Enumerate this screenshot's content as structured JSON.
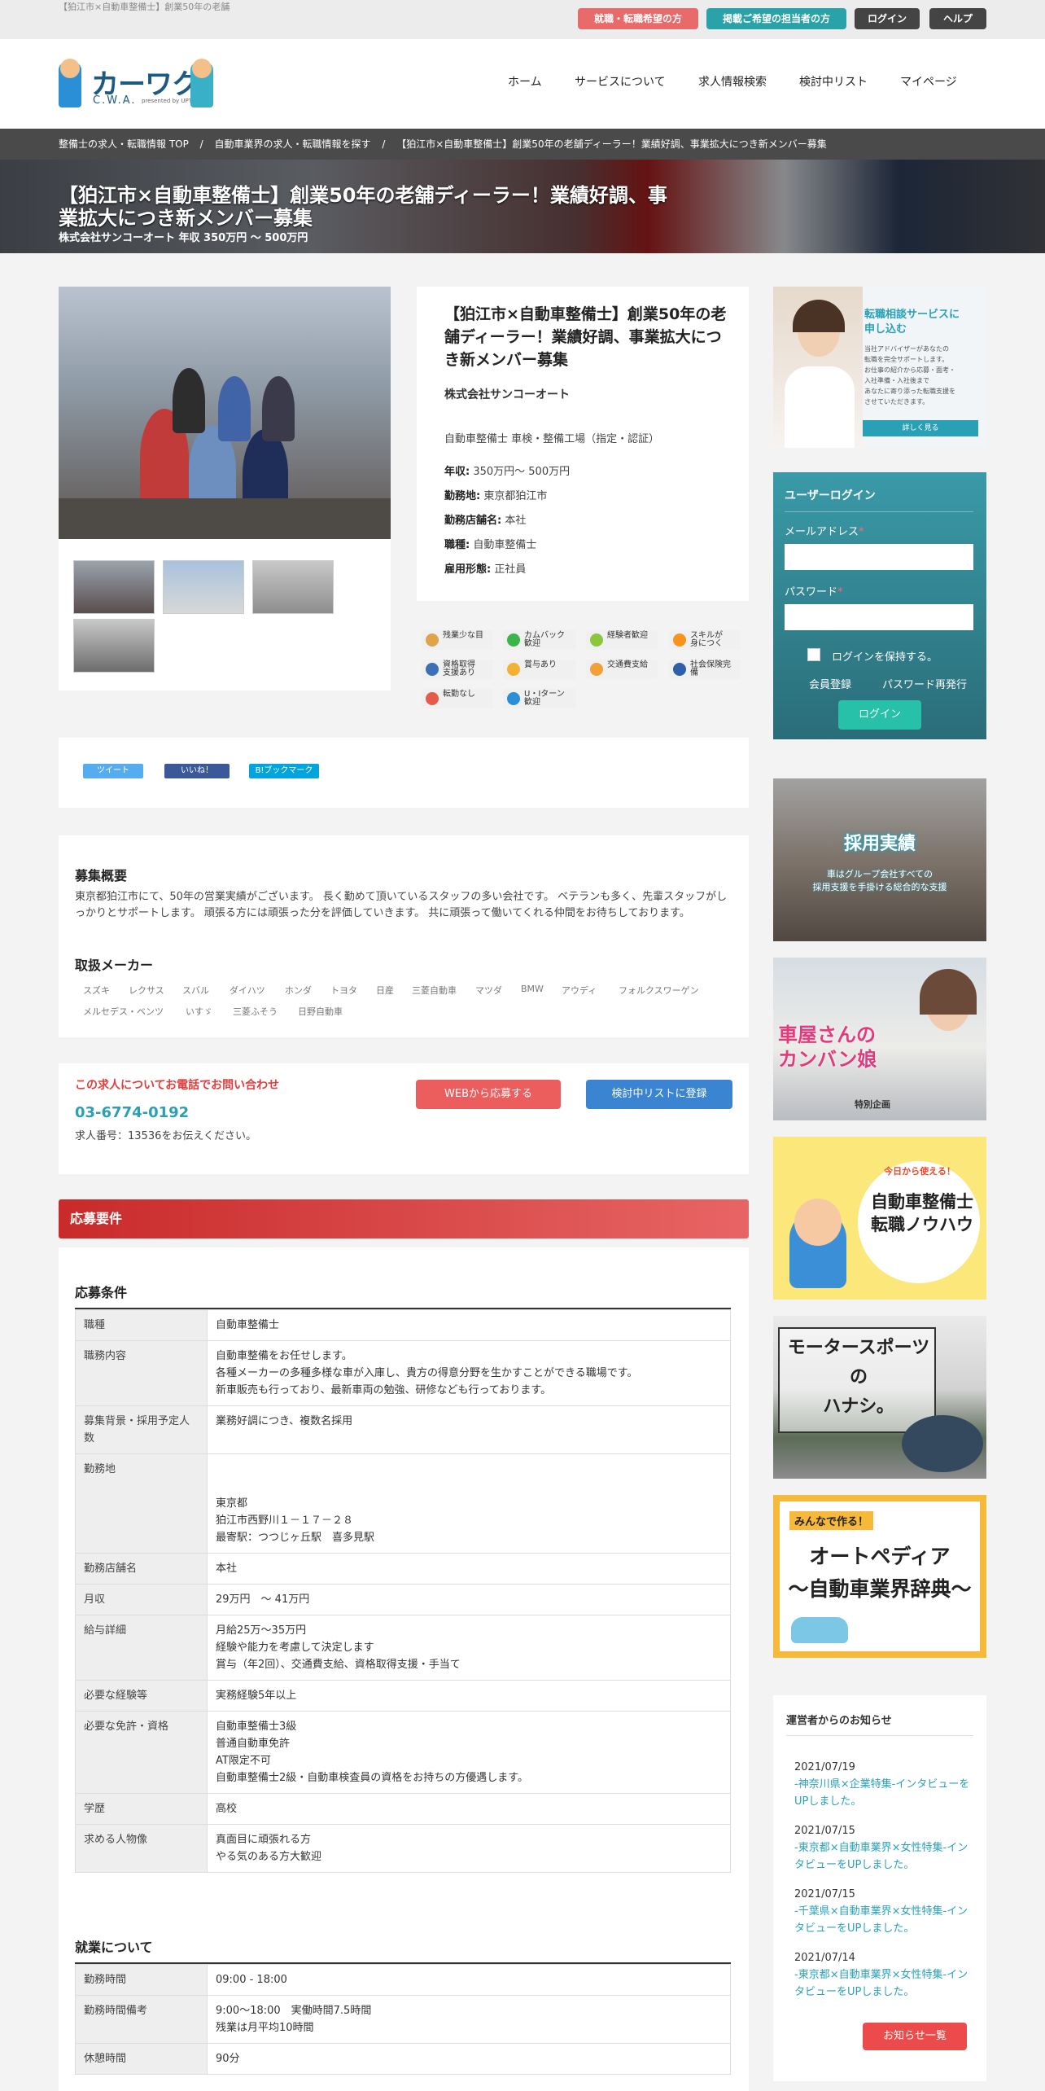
{
  "topbar": {
    "tagline": "【狛江市×自動車整備士】創業50年の老舗",
    "btn_jobseeker": "就職・転職希望の方",
    "btn_employer": "掲載ご希望の担当者の方",
    "btn_login": "ログイン",
    "btn_help": "ヘルプ"
  },
  "header": {
    "logo_text": "カーワク",
    "logo_sub": "C.W.A.",
    "logo_powered": "presented by UPTV",
    "nav": [
      "ホーム",
      "サービスについて",
      "求人情報検索",
      "検討中リスト",
      "マイページ"
    ]
  },
  "breadcrumb": {
    "items": [
      "整備士の求人・転職情報 TOP",
      "/",
      "自動車業界の求人・転職情報を探す",
      "/",
      "【狛江市×自動車整備士】創業50年の老舗ディーラー！業績好調、事業拡大につき新メンバー募集"
    ]
  },
  "hero": {
    "title": "【狛江市×自動車整備士】創業50年の老舗ディーラー！業績好調、事業拡大につき新メンバー募集",
    "subtitle": "株式会社サンコーオート 年収 350万円 〜 500万円"
  },
  "job": {
    "title": "【狛江市×自動車整備士】創業50年の老舗ディーラー！業績好調、事業拡大につき新メンバー募集",
    "company": "株式会社サンコーオート",
    "description": "自動車整備士 車検・整備工場（指定・認証）",
    "fields": [
      {
        "label": "年収:",
        "value": " 350万円〜 500万円"
      },
      {
        "label": "勤務地:",
        "value": " 東京都狛江市"
      },
      {
        "label": "勤務店舗名:",
        "value": " 本社"
      },
      {
        "label": "職種:",
        "value": " 自動車整備士"
      },
      {
        "label": "雇用形態:",
        "value": " 正社員"
      }
    ]
  },
  "badges": [
    {
      "label": "残業少な目",
      "color": "#e0a24a"
    },
    {
      "label": "カムバック\n歓迎",
      "color": "#39b54a"
    },
    {
      "label": "経験者歓迎",
      "color": "#8cc63f"
    },
    {
      "label": "スキルが\n身につく",
      "color": "#f7931e"
    },
    {
      "label": "資格取得\n支援あり",
      "color": "#3b6fb6"
    },
    {
      "label": "賞与あり",
      "color": "#f2b134"
    },
    {
      "label": "交通費支給",
      "color": "#f2a03a"
    },
    {
      "label": "社会保険完備",
      "color": "#2e5fa8"
    },
    {
      "label": "転勤なし",
      "color": "#e55a4a"
    },
    {
      "label": "U・Iターン\n歓迎",
      "color": "#2a8fd6"
    }
  ],
  "share": {
    "tweet": "ツイート",
    "like": "いいね！",
    "bookmark": "B!ブックマーク"
  },
  "overview": {
    "heading": "募集概要",
    "text": "東京都狛江市にて、50年の営業実績がございます。 長く勤めて頂いているスタッフの多い会社です。 ベテランも多く、先輩スタッフがしっかりとサポートします。 頑張る方には頑張った分を評価していきます。 共に頑張って働いてくれる仲間をお待ちしております。",
    "makers_heading": "取扱メーカー",
    "makers": [
      "スズキ",
      "レクサス",
      "スバル",
      "ダイハツ",
      "ホンダ",
      "トヨタ",
      "日産",
      "三菱自動車",
      "マツダ",
      "BMW",
      "アウディ",
      "フォルクスワーゲン",
      "メルセデス・ベンツ",
      "いすゞ",
      "三菱ふそう",
      "日野自動車"
    ]
  },
  "contact": {
    "heading": "この求人についてお電話でお問い合わせ",
    "phone": "03-6774-0192",
    "job_no": "求人番号：13536をお伝えください。",
    "btn_apply": "WEBから応募する",
    "btn_list": "検討中リストに登録"
  },
  "requirements": {
    "bar": "応募要件",
    "conditions_heading": "応募条件",
    "conditions": [
      {
        "k": "職種",
        "v": "自動車整備士"
      },
      {
        "k": "職務内容",
        "v": "自動車整備をお任せします。\n各種メーカーの多種多様な車が入庫し、貴方の得意分野を生かすことができる職場です。\n新車販売も行っており、最新車両の勉強、研修なども行っております。"
      },
      {
        "k": "募集背景・採用予定人数",
        "v": "業務好調につき、複数名採用"
      },
      {
        "k": "勤務地",
        "v": "\n\n東京都\n狛江市西野川１－１７－２８\n最寄駅：つつじヶ丘駅　喜多見駅"
      },
      {
        "k": "勤務店舗名",
        "v": "本社"
      },
      {
        "k": "月収",
        "v": "29万円　〜 41万円"
      },
      {
        "k": "給与詳細",
        "v": "月給25万～35万円\n経験や能力を考慮して決定します\n賞与（年2回）、交通費支給、資格取得支援・手当て"
      },
      {
        "k": "必要な経験等",
        "v": "実務経験5年以上"
      },
      {
        "k": "必要な免許・資格",
        "v": "自動車整備士3級\n普通自動車免許\nAT限定不可\n自動車整備士2級・自動車検査員の資格をお持ちの方優遇します。"
      },
      {
        "k": "学歴",
        "v": "高校"
      },
      {
        "k": "求める人物像",
        "v": "真面目に頑張れる方\nやる気のある方大歓迎"
      }
    ],
    "work_heading": "就業について",
    "work": [
      {
        "k": "勤務時間",
        "v": "09:00 - 18:00"
      },
      {
        "k": "勤務時間備考",
        "v": "9:00～18:00　実働時間7.5時間\n残業は月平均10時間"
      },
      {
        "k": "休憩時間",
        "v": "90分"
      }
    ]
  },
  "sidebar": {
    "consult_banner": {
      "title": "転職相談サービスに\n申し込む",
      "body": "当社アドバイザーがあなたの\n転職を完全サポートします。\nお仕事の紹介から応募・面考・\n入社準備・入社後まで\nあなたに寄り添った転職支援を\nさせていただきます。",
      "btn": "詳しく見る"
    },
    "login": {
      "title": "ユーザーログイン",
      "email_label": "メールアドレス",
      "password_label": "パスワード",
      "required_mark": "*",
      "remember": "ログインを保持する。",
      "register": "会員登録",
      "reset": "パスワード再発行",
      "submit": "ログイン"
    },
    "banners": [
      {
        "title": "採用実績",
        "sub": "車はグループ会社すべての\n採用支援を手掛ける総合的な支援"
      },
      {
        "title": "車屋さんの\nカンバン娘",
        "sub": "特別企画"
      },
      {
        "title": "自動車整備士\n転職ノウハウ",
        "sub": "今日から使える！"
      },
      {
        "title": "モータースポーツ\nの\nハナシ。",
        "sub": ""
      },
      {
        "title": "オートペディア\n〜自動車業界辞典〜",
        "sub": "みんなで作る！"
      }
    ],
    "news": {
      "title": "運営者からのお知らせ",
      "items": [
        {
          "date": "2021/07/19",
          "text": "-神奈川県×企業特集-インタビューをUPしました。"
        },
        {
          "date": "2021/07/15",
          "text": "-東京都×自動車業界×女性特集-インタビューをUPしました。"
        },
        {
          "date": "2021/07/15",
          "text": "-千葉県×自動車業界×女性特集-インタビューをUPしました。"
        },
        {
          "date": "2021/07/14",
          "text": "-東京都×自動車業界×女性特集-インタビューをUPしました。"
        }
      ],
      "more": "お知らせ一覧"
    }
  }
}
